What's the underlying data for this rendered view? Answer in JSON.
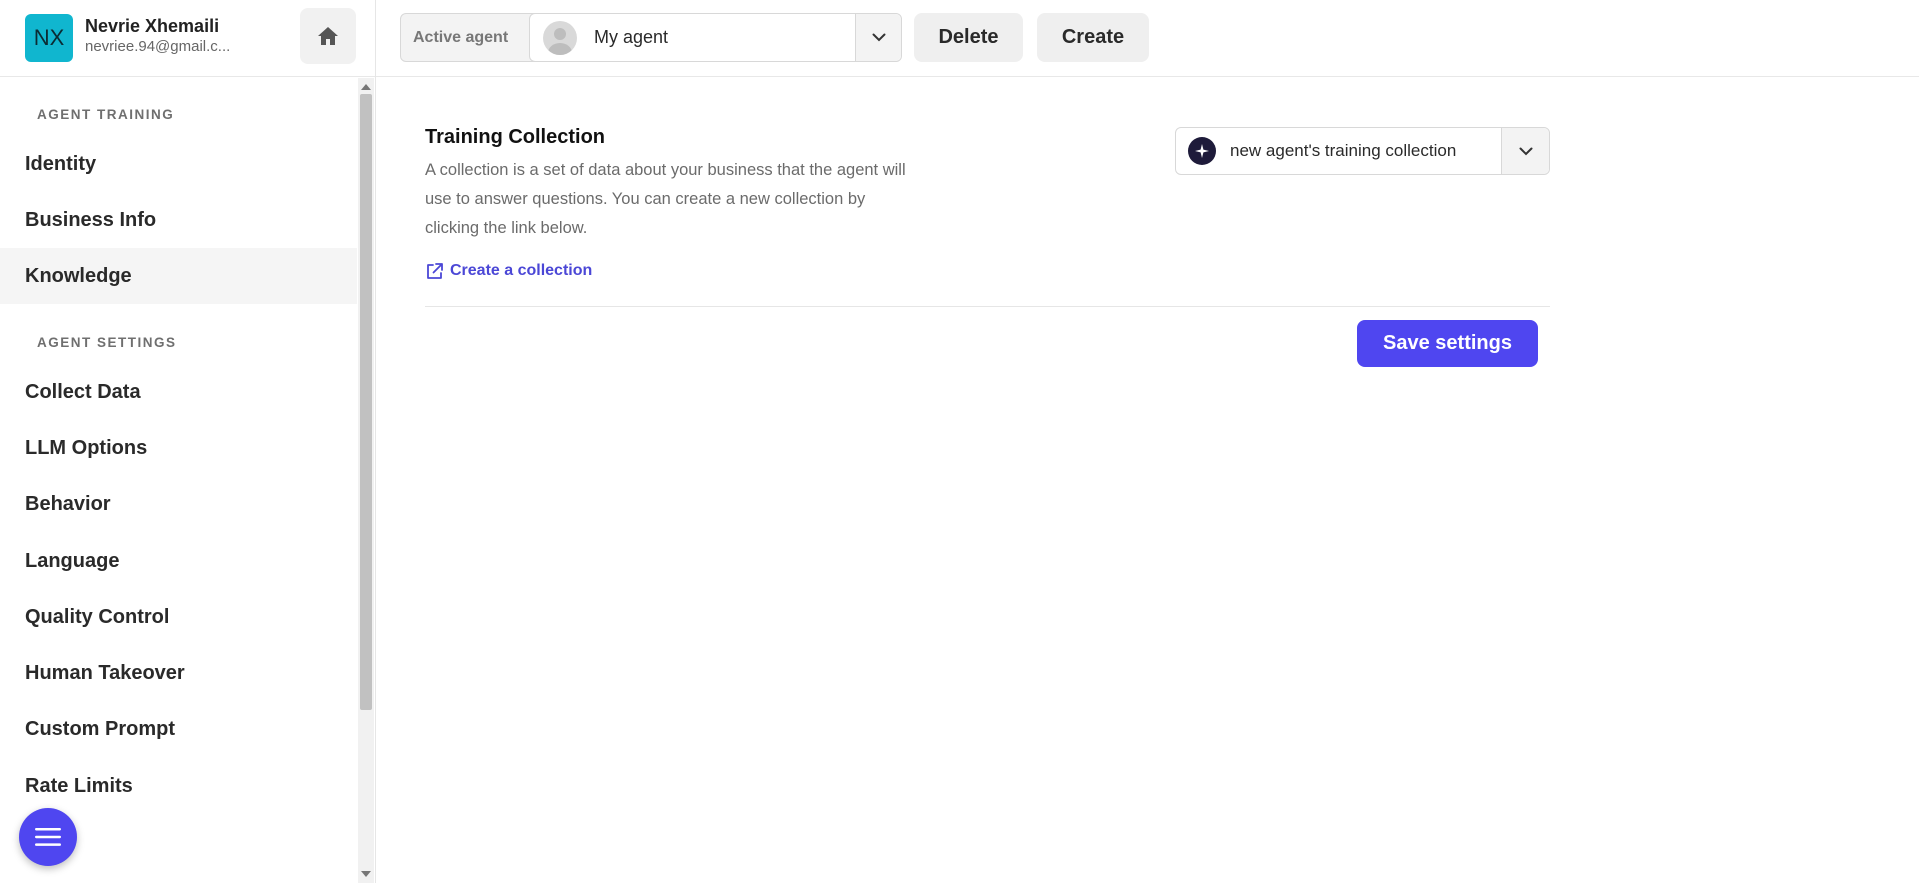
{
  "user": {
    "initials": "NX",
    "name": "Nevrie Xhemaili",
    "email": "nevriee.94@gmail.c..."
  },
  "sidebar": {
    "sections": [
      {
        "label": "AGENT TRAINING",
        "items": [
          "Identity",
          "Business Info",
          "Knowledge"
        ]
      },
      {
        "label": "AGENT SETTINGS",
        "items": [
          "Collect Data",
          "LLM Options",
          "Behavior",
          "Language",
          "Quality Control",
          "Human Takeover",
          "Custom Prompt",
          "Rate Limits"
        ]
      }
    ],
    "active_item": "Knowledge"
  },
  "topbar": {
    "active_agent_label": "Active agent",
    "agent_name": "My agent",
    "delete_label": "Delete",
    "create_label": "Create"
  },
  "main": {
    "title": "Training Collection",
    "description": "A collection is a set of data about your business that the agent will use to answer questions. You can create a new collection by clicking the link below.",
    "create_link": "Create a collection",
    "selected_collection": "new agent's training collection",
    "save_label": "Save settings"
  },
  "colors": {
    "accent": "#4f46f0",
    "avatar_bg": "#10b6cf",
    "link": "#4b47d6"
  },
  "icons": {
    "home": "home-icon",
    "chevron": "chevron-down-icon",
    "external_link": "external-link-icon",
    "sparkle": "sparkle-icon",
    "menu": "menu-icon"
  }
}
